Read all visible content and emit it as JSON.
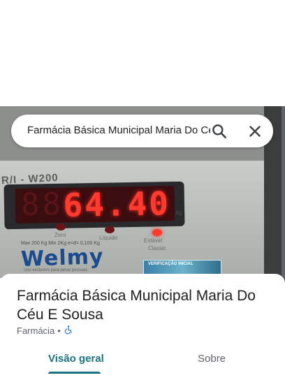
{
  "search": {
    "query": "Farmácia Básica Municipal Maria Do Céu E Sousa"
  },
  "photo": {
    "scale_reading": "64.40",
    "ghost_digits": "88",
    "unit": "kg",
    "model_text": "R/I - W200",
    "indicator_labels": [
      "Zero",
      "Líquido",
      "Estável"
    ],
    "specs": "Max 200 Kg  Min 2Kg  e=d= 0,100 Kg",
    "brand": "Welmy",
    "brand_sub": "Uso exclusivo para pesar pessoas",
    "sticker_text": "VERIFICAÇÃO INICIAL",
    "classic_label": "Classic"
  },
  "place": {
    "title": "Farmácia Básica Municipal Maria Do Céu E Sousa",
    "category": "Farmácia",
    "separator": "•",
    "accessibility_icon": "wheelchair-icon"
  },
  "tabs": [
    {
      "label": "Visão geral",
      "active": true
    },
    {
      "label": "Sobre",
      "active": false
    }
  ],
  "colors": {
    "accent": "#1a7380",
    "lcd_red": "#ff3b30",
    "brand_blue": "#1b4a8f",
    "accessibility_blue": "#1a73e8"
  }
}
